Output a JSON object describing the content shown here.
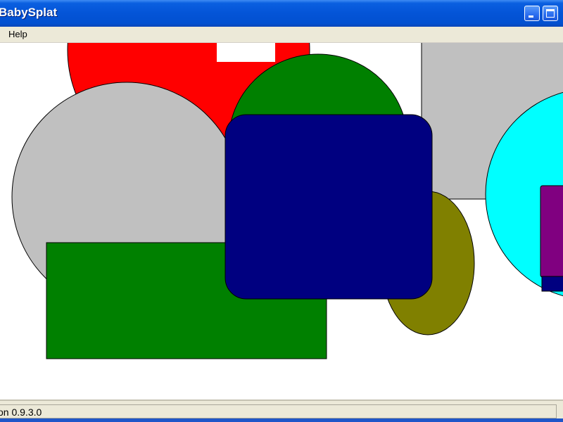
{
  "window": {
    "title": "BabySplat"
  },
  "controls": {
    "minimize": "minimize",
    "maximize": "maximize"
  },
  "menu": {
    "items": [
      {
        "label": "Help"
      }
    ]
  },
  "canvas": {
    "shapes": [
      {
        "name": "red-circle",
        "fill": "#ff0000"
      },
      {
        "name": "white-square",
        "fill": "#ffffff"
      },
      {
        "name": "green-circle",
        "fill": "#008000"
      },
      {
        "name": "gray-rectangle",
        "fill": "#c0c0c0"
      },
      {
        "name": "cyan-circle",
        "fill": "#00ffff"
      },
      {
        "name": "purple-rectangle",
        "fill": "#800080"
      },
      {
        "name": "navy-rectangle-small",
        "fill": "#000080"
      },
      {
        "name": "gray-circle",
        "fill": "#c0c0c0"
      },
      {
        "name": "olive-ellipse",
        "fill": "#808000"
      },
      {
        "name": "green-rectangle",
        "fill": "#008000"
      },
      {
        "name": "navy-rounded-rectangle",
        "fill": "#000080"
      }
    ]
  },
  "statusbar": {
    "text": "on 0.9.3.0"
  }
}
